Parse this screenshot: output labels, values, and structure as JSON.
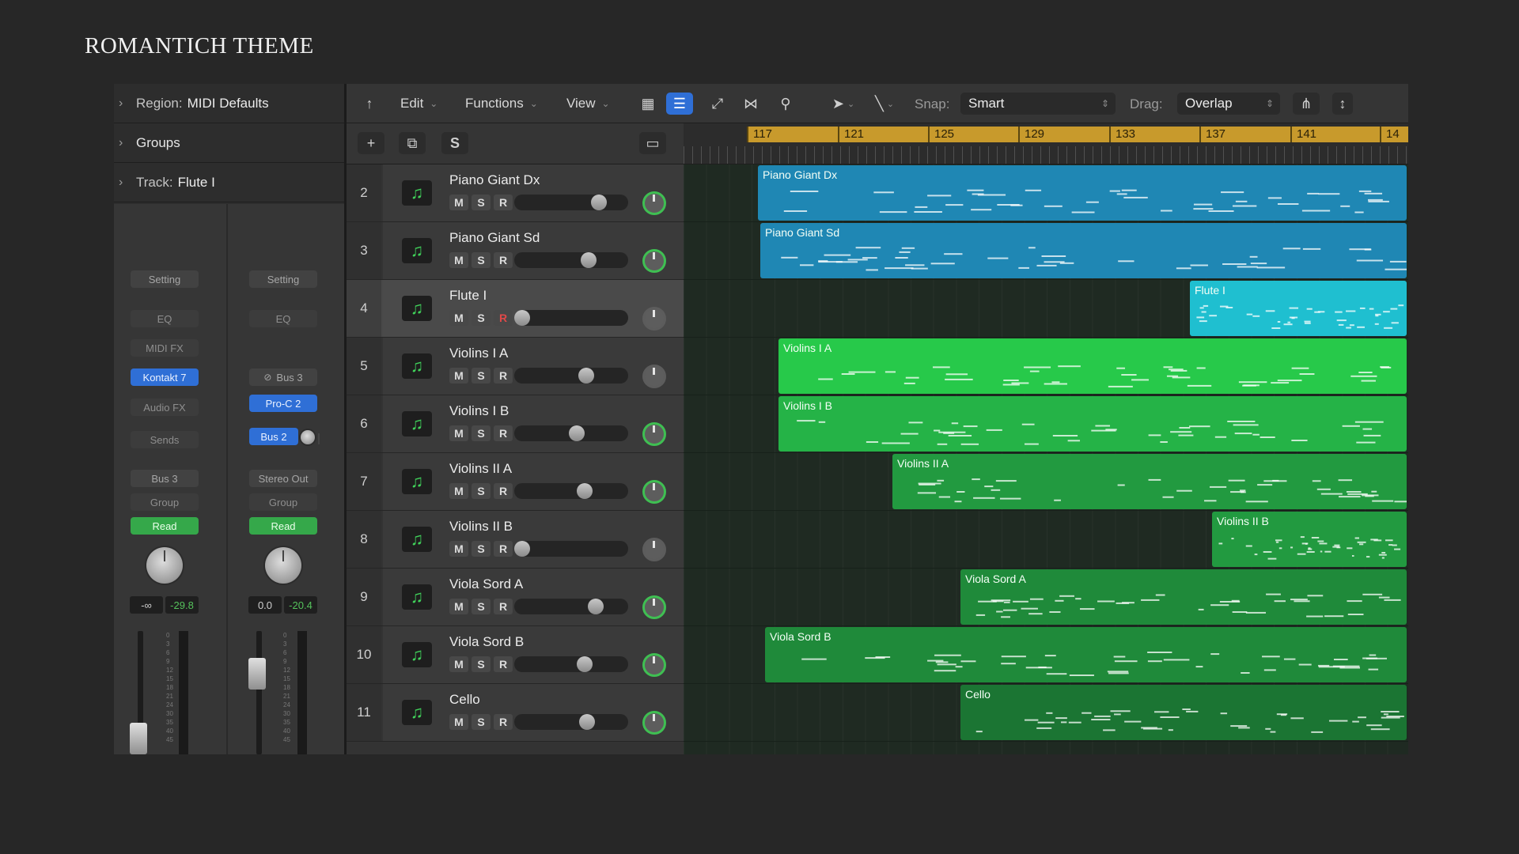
{
  "slide_title": "ROMANTICH THEME",
  "inspector": {
    "region_label": "Region:",
    "region_value": "MIDI Defaults",
    "groups_label": "Groups",
    "track_label": "Track:",
    "track_value": "Flute I",
    "strip1": {
      "setting": "Setting",
      "eq": "EQ",
      "midi_fx": "MIDI FX",
      "instrument": "Kontakt 7",
      "audio_fx": "Audio FX",
      "sends": "Sends",
      "output": "Bus 3",
      "group": "Group",
      "automation": "Read",
      "value_left": "-∞",
      "value_right": "-29.8"
    },
    "strip2": {
      "setting": "Setting",
      "eq": "EQ",
      "input": "Bus 3",
      "plugin": "Pro-C 2",
      "send": "Bus 2",
      "output": "Stereo Out",
      "group": "Group",
      "automation": "Read",
      "value_left": "0.0",
      "value_right": "-20.4"
    },
    "fader_scale": [
      "0",
      "3",
      "6",
      "9",
      "12",
      "15",
      "18",
      "21",
      "24",
      "30",
      "35",
      "40",
      "45"
    ]
  },
  "toolbar": {
    "edit": "Edit",
    "functions": "Functions",
    "view": "View",
    "snap_label": "Snap:",
    "snap_value": "Smart",
    "drag_label": "Drag:",
    "drag_value": "Overlap"
  },
  "track_header": {
    "add": "+",
    "solo": "S"
  },
  "ruler_marks": [
    "117",
    "121",
    "125",
    "129",
    "133",
    "137",
    "141",
    "14"
  ],
  "button_labels": {
    "mute": "M",
    "solo": "S",
    "record": "R"
  },
  "tracks": [
    {
      "num": "2",
      "name": "Piano Giant Dx",
      "volume": 0.78,
      "pan_on": true,
      "selected": false,
      "rec_armed": false
    },
    {
      "num": "3",
      "name": "Piano Giant Sd",
      "volume": 0.68,
      "pan_on": true,
      "selected": false,
      "rec_armed": false
    },
    {
      "num": "4",
      "name": "Flute I",
      "volume": 0.0,
      "pan_on": false,
      "selected": true,
      "rec_armed": true
    },
    {
      "num": "5",
      "name": "Violins I A",
      "volume": 0.65,
      "pan_on": false,
      "selected": false,
      "rec_armed": false
    },
    {
      "num": "6",
      "name": "Violins I B",
      "volume": 0.56,
      "pan_on": true,
      "selected": false,
      "rec_armed": false
    },
    {
      "num": "7",
      "name": "Violins II A",
      "volume": 0.64,
      "pan_on": true,
      "selected": false,
      "rec_armed": false
    },
    {
      "num": "8",
      "name": "Violins II B",
      "volume": 0.0,
      "pan_on": false,
      "selected": false,
      "rec_armed": false
    },
    {
      "num": "9",
      "name": "Viola Sord A",
      "volume": 0.75,
      "pan_on": true,
      "selected": false,
      "rec_armed": false
    },
    {
      "num": "10",
      "name": "Viola Sord B",
      "volume": 0.64,
      "pan_on": true,
      "selected": false,
      "rec_armed": false
    },
    {
      "num": "11",
      "name": "Cello",
      "volume": 0.66,
      "pan_on": true,
      "selected": false,
      "rec_armed": false
    }
  ],
  "regions": [
    {
      "name": "Piano Giant Dx",
      "start_bar": 117.5,
      "color": "#1f87b4"
    },
    {
      "name": "Piano Giant Sd",
      "start_bar": 117.6,
      "color": "#1f87b4"
    },
    {
      "name": "Flute I",
      "start_bar": 136.5,
      "color": "#1fbfd0"
    },
    {
      "name": "Violins I A",
      "start_bar": 118.4,
      "color": "#27c94a"
    },
    {
      "name": "Violins I B",
      "start_bar": 118.4,
      "color": "#25b347"
    },
    {
      "name": "Violins II A",
      "start_bar": 123.4,
      "color": "#229a40"
    },
    {
      "name": "Violins II B",
      "start_bar": 137.5,
      "color": "#229a40"
    },
    {
      "name": "Viola Sord A",
      "start_bar": 126.4,
      "color": "#1f8a3a"
    },
    {
      "name": "Viola Sord B",
      "start_bar": 117.8,
      "color": "#1f8a3a"
    },
    {
      "name": "Cello",
      "start_bar": 126.4,
      "color": "#1b7533"
    }
  ]
}
